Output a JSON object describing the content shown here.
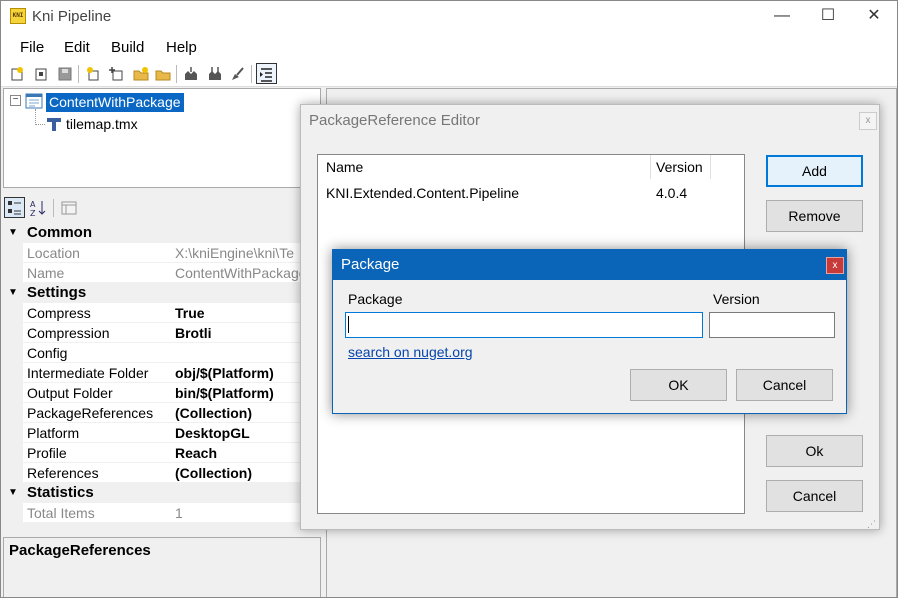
{
  "window": {
    "title": "Kni Pipeline",
    "icon_label": "KNI",
    "minimize": "—",
    "maximize": "☐",
    "close": "✕"
  },
  "menu": [
    "File",
    "Edit",
    "Build",
    "Help"
  ],
  "tree": {
    "root": "ContentWithPackage",
    "child": "tilemap.tmx"
  },
  "properties": {
    "categories": {
      "common": "Common",
      "settings": "Settings",
      "statistics": "Statistics"
    },
    "common_rows": [
      {
        "name": "Location",
        "value": "X:\\kniEngine\\kni\\Te"
      },
      {
        "name": "Name",
        "value": "ContentWithPackage"
      }
    ],
    "settings_rows": [
      {
        "name": "Compress",
        "value": "True"
      },
      {
        "name": "Compression",
        "value": "Brotli"
      },
      {
        "name": "Config",
        "value": ""
      },
      {
        "name": "Intermediate Folder",
        "value": "obj/$(Platform)"
      },
      {
        "name": "Output Folder",
        "value": "bin/$(Platform)"
      },
      {
        "name": "PackageReferences",
        "value": "(Collection)"
      },
      {
        "name": "Platform",
        "value": "DesktopGL"
      },
      {
        "name": "Profile",
        "value": "Reach"
      },
      {
        "name": "References",
        "value": "(Collection)"
      }
    ],
    "statistics_rows": [
      {
        "name": "Total Items",
        "value": "1"
      }
    ],
    "description_title": "PackageReferences"
  },
  "editor": {
    "title": "PackageReference Editor",
    "close": "x",
    "columns": {
      "name": "Name",
      "version": "Version"
    },
    "rows": [
      {
        "name": "KNI.Extended.Content.Pipeline",
        "version": "4.0.4"
      }
    ],
    "add": "Add",
    "remove": "Remove",
    "ok": "Ok",
    "cancel": "Cancel"
  },
  "dialog": {
    "title": "Package",
    "close": "x",
    "package_label": "Package",
    "version_label": "Version",
    "package_value": "",
    "version_value": "",
    "nuget_link": "search on nuget.org",
    "ok": "OK",
    "cancel": "Cancel"
  }
}
